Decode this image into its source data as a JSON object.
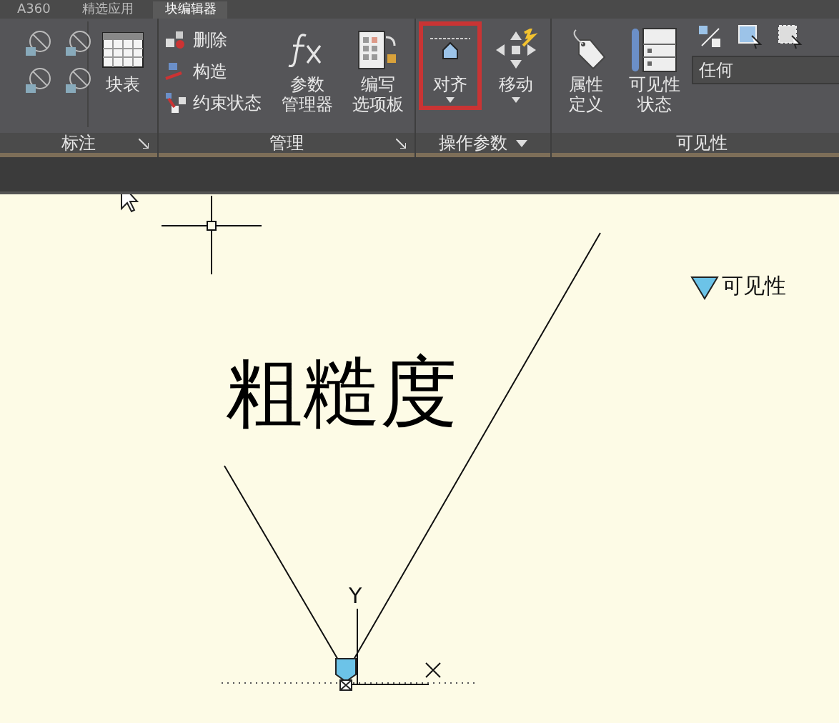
{
  "tabs": [
    {
      "label": "A360",
      "selected": false
    },
    {
      "label": "精选应用",
      "selected": false
    },
    {
      "label": "块编辑器",
      "selected": true
    }
  ],
  "ribbon": {
    "panels": [
      {
        "title": "标注",
        "items": [
          {
            "kind": "icon-grid"
          },
          {
            "kind": "large",
            "lines": [
              "块表"
            ],
            "dropdown": false,
            "highlighted": false
          }
        ]
      },
      {
        "title": "管理",
        "items": [
          {
            "kind": "small",
            "lines": [
              "删除"
            ],
            "highlighted": false
          },
          {
            "kind": "small",
            "lines": [
              "构造"
            ],
            "highlighted": false
          },
          {
            "kind": "small",
            "lines": [
              "约束状态"
            ],
            "highlighted": false
          },
          {
            "kind": "large",
            "lines": [
              "参数",
              "管理器"
            ],
            "dropdown": false,
            "highlighted": false
          },
          {
            "kind": "large",
            "lines": [
              "编写",
              "选项板"
            ],
            "dropdown": false,
            "highlighted": false
          }
        ]
      },
      {
        "title": "操作参数",
        "items": [
          {
            "kind": "large",
            "lines": [
              "对齐"
            ],
            "dropdown": true,
            "highlighted": true
          },
          {
            "kind": "large",
            "lines": [
              "移动"
            ],
            "dropdown": true,
            "highlighted": false
          }
        ]
      },
      {
        "title": "可见性",
        "items": [
          {
            "kind": "large",
            "lines": [
              "属性",
              "定义"
            ],
            "dropdown": false,
            "highlighted": false
          },
          {
            "kind": "large",
            "lines": [
              "可见性",
              "状态"
            ],
            "dropdown": false,
            "highlighted": false
          },
          {
            "kind": "combo",
            "value": "任何",
            "highlighted": false
          }
        ]
      }
    ]
  },
  "canvas": {
    "text": "粗糙度",
    "parameter_label": "可见性",
    "axis_y": "Y"
  }
}
